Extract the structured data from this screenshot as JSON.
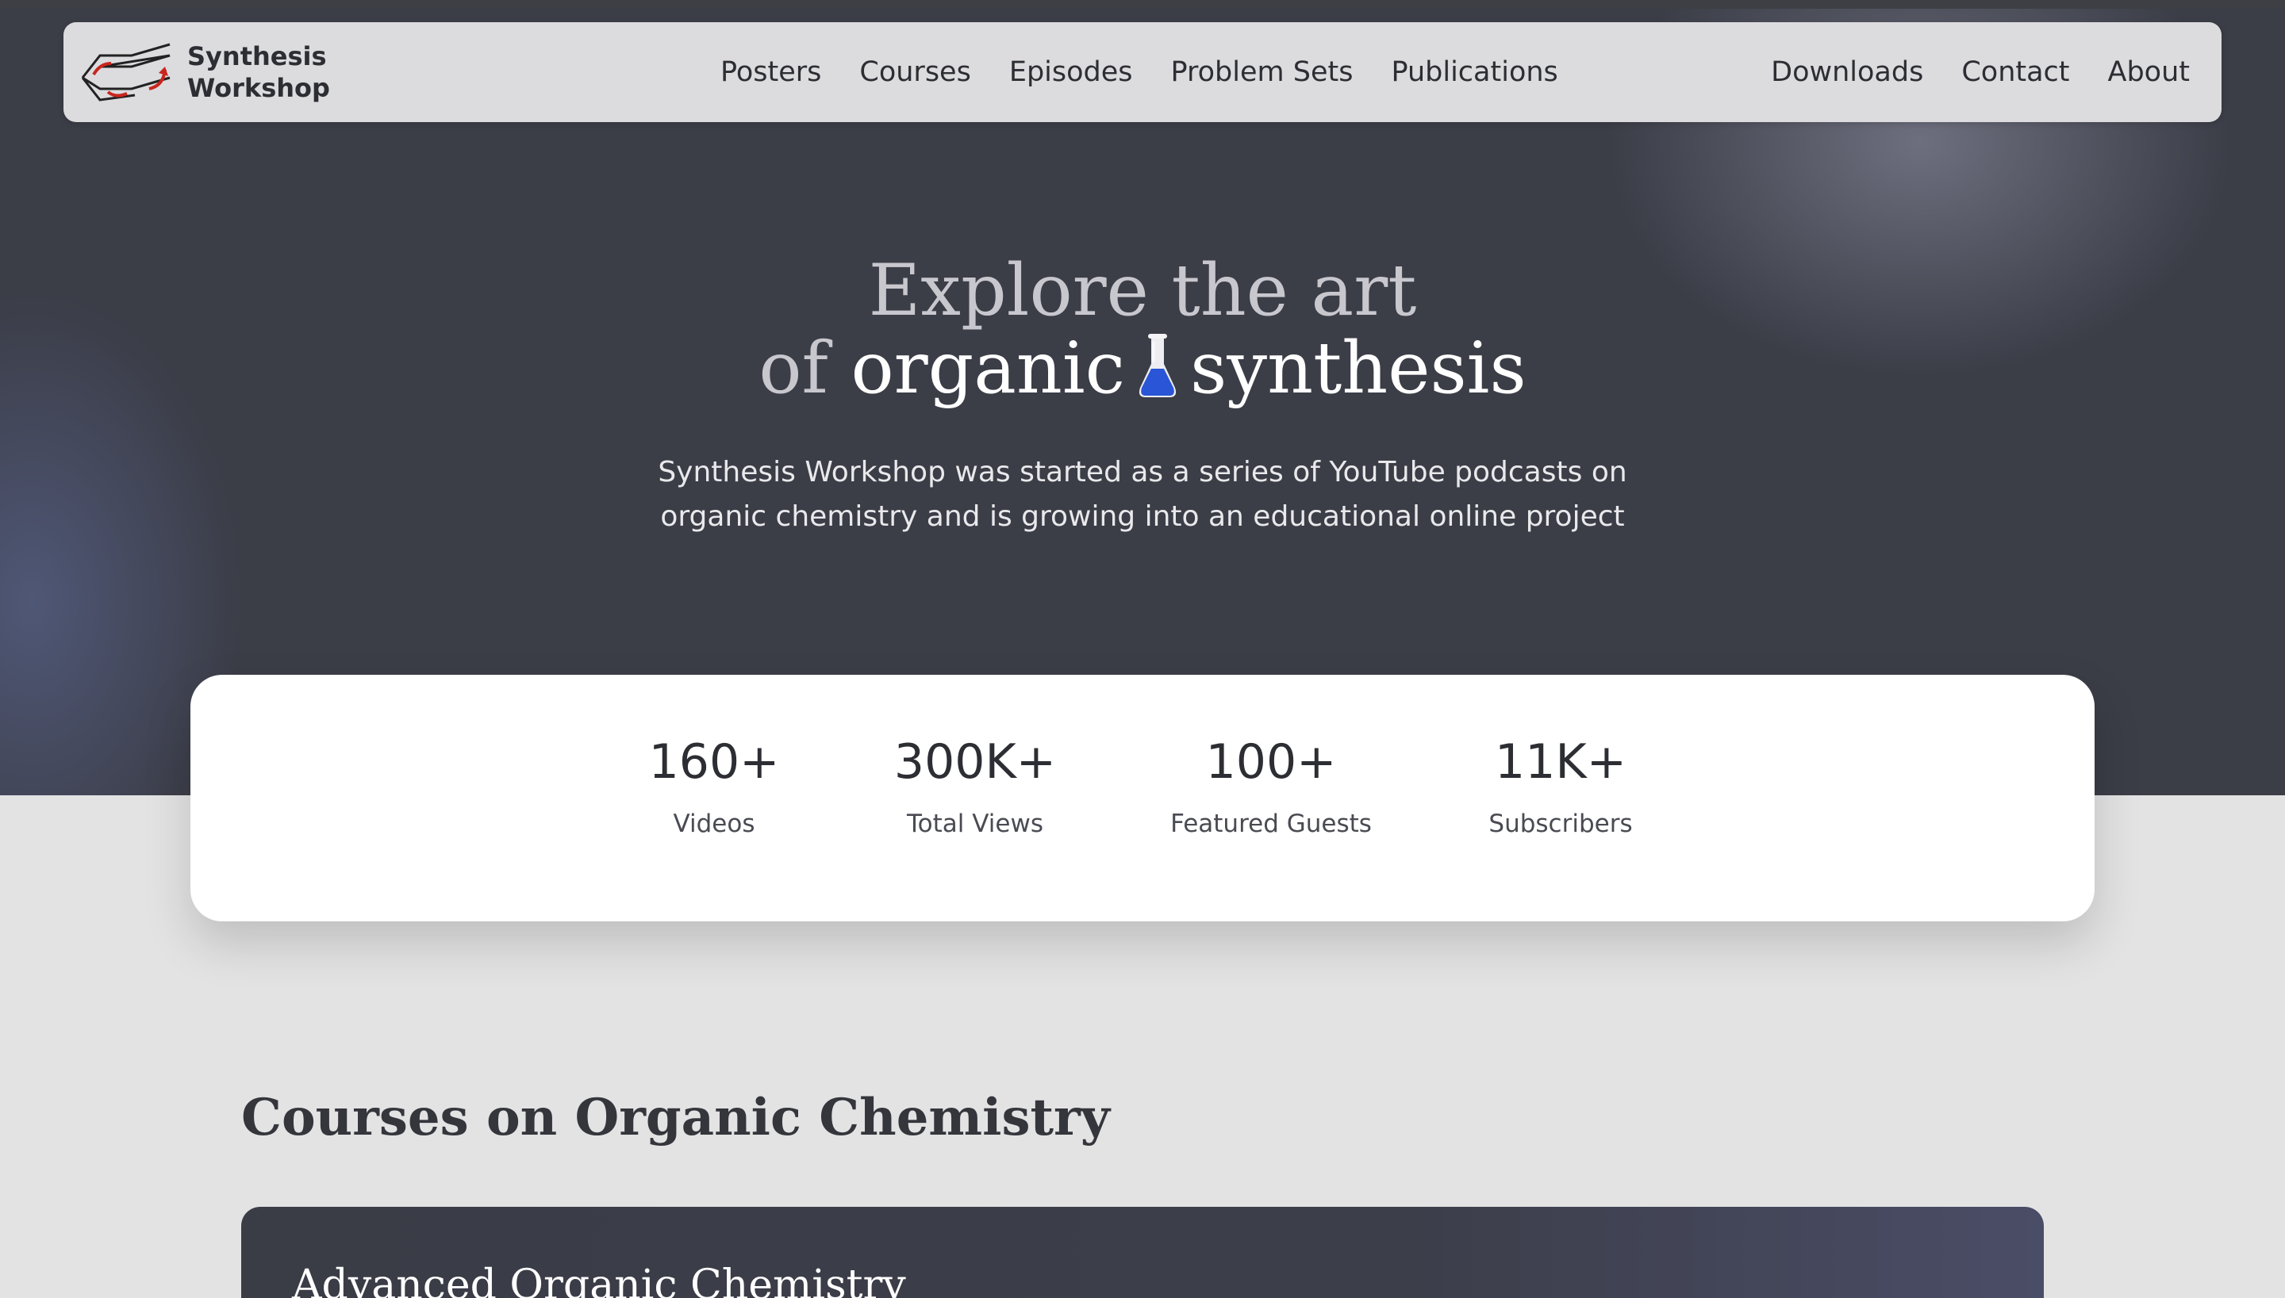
{
  "brand": {
    "line1": "Synthesis",
    "line2": "Workshop",
    "logo_icon": "cyclohexane-logo-icon"
  },
  "nav": {
    "primary": [
      "Posters",
      "Courses",
      "Episodes",
      "Problem Sets",
      "Publications"
    ],
    "secondary": [
      "Downloads",
      "Contact",
      "About"
    ]
  },
  "hero": {
    "title_line1": "Explore the art",
    "title_of": "of",
    "title_organic": "organic",
    "title_icon": "flask-icon",
    "title_synthesis": "synthesis",
    "subtitle_line1": "Synthesis Workshop was started as a series of YouTube podcasts on",
    "subtitle_line2": "organic chemistry and is growing into an educational online project"
  },
  "stats": [
    {
      "value": "160+",
      "label": "Videos"
    },
    {
      "value": "300K+",
      "label": "Total Views"
    },
    {
      "value": "100+",
      "label": "Featured Guests"
    },
    {
      "value": "11K+",
      "label": "Subscribers"
    }
  ],
  "courses_section": {
    "title": "Courses on Organic Chemistry",
    "first_course_title": "Advanced Organic Chemistry"
  },
  "colors": {
    "hero_bg": "#3b3d47",
    "navbar_bg": "#dcdcdf",
    "page_bg": "#e3e3e4",
    "flask_blue": "#2a55d6",
    "logo_red": "#c8261e"
  }
}
